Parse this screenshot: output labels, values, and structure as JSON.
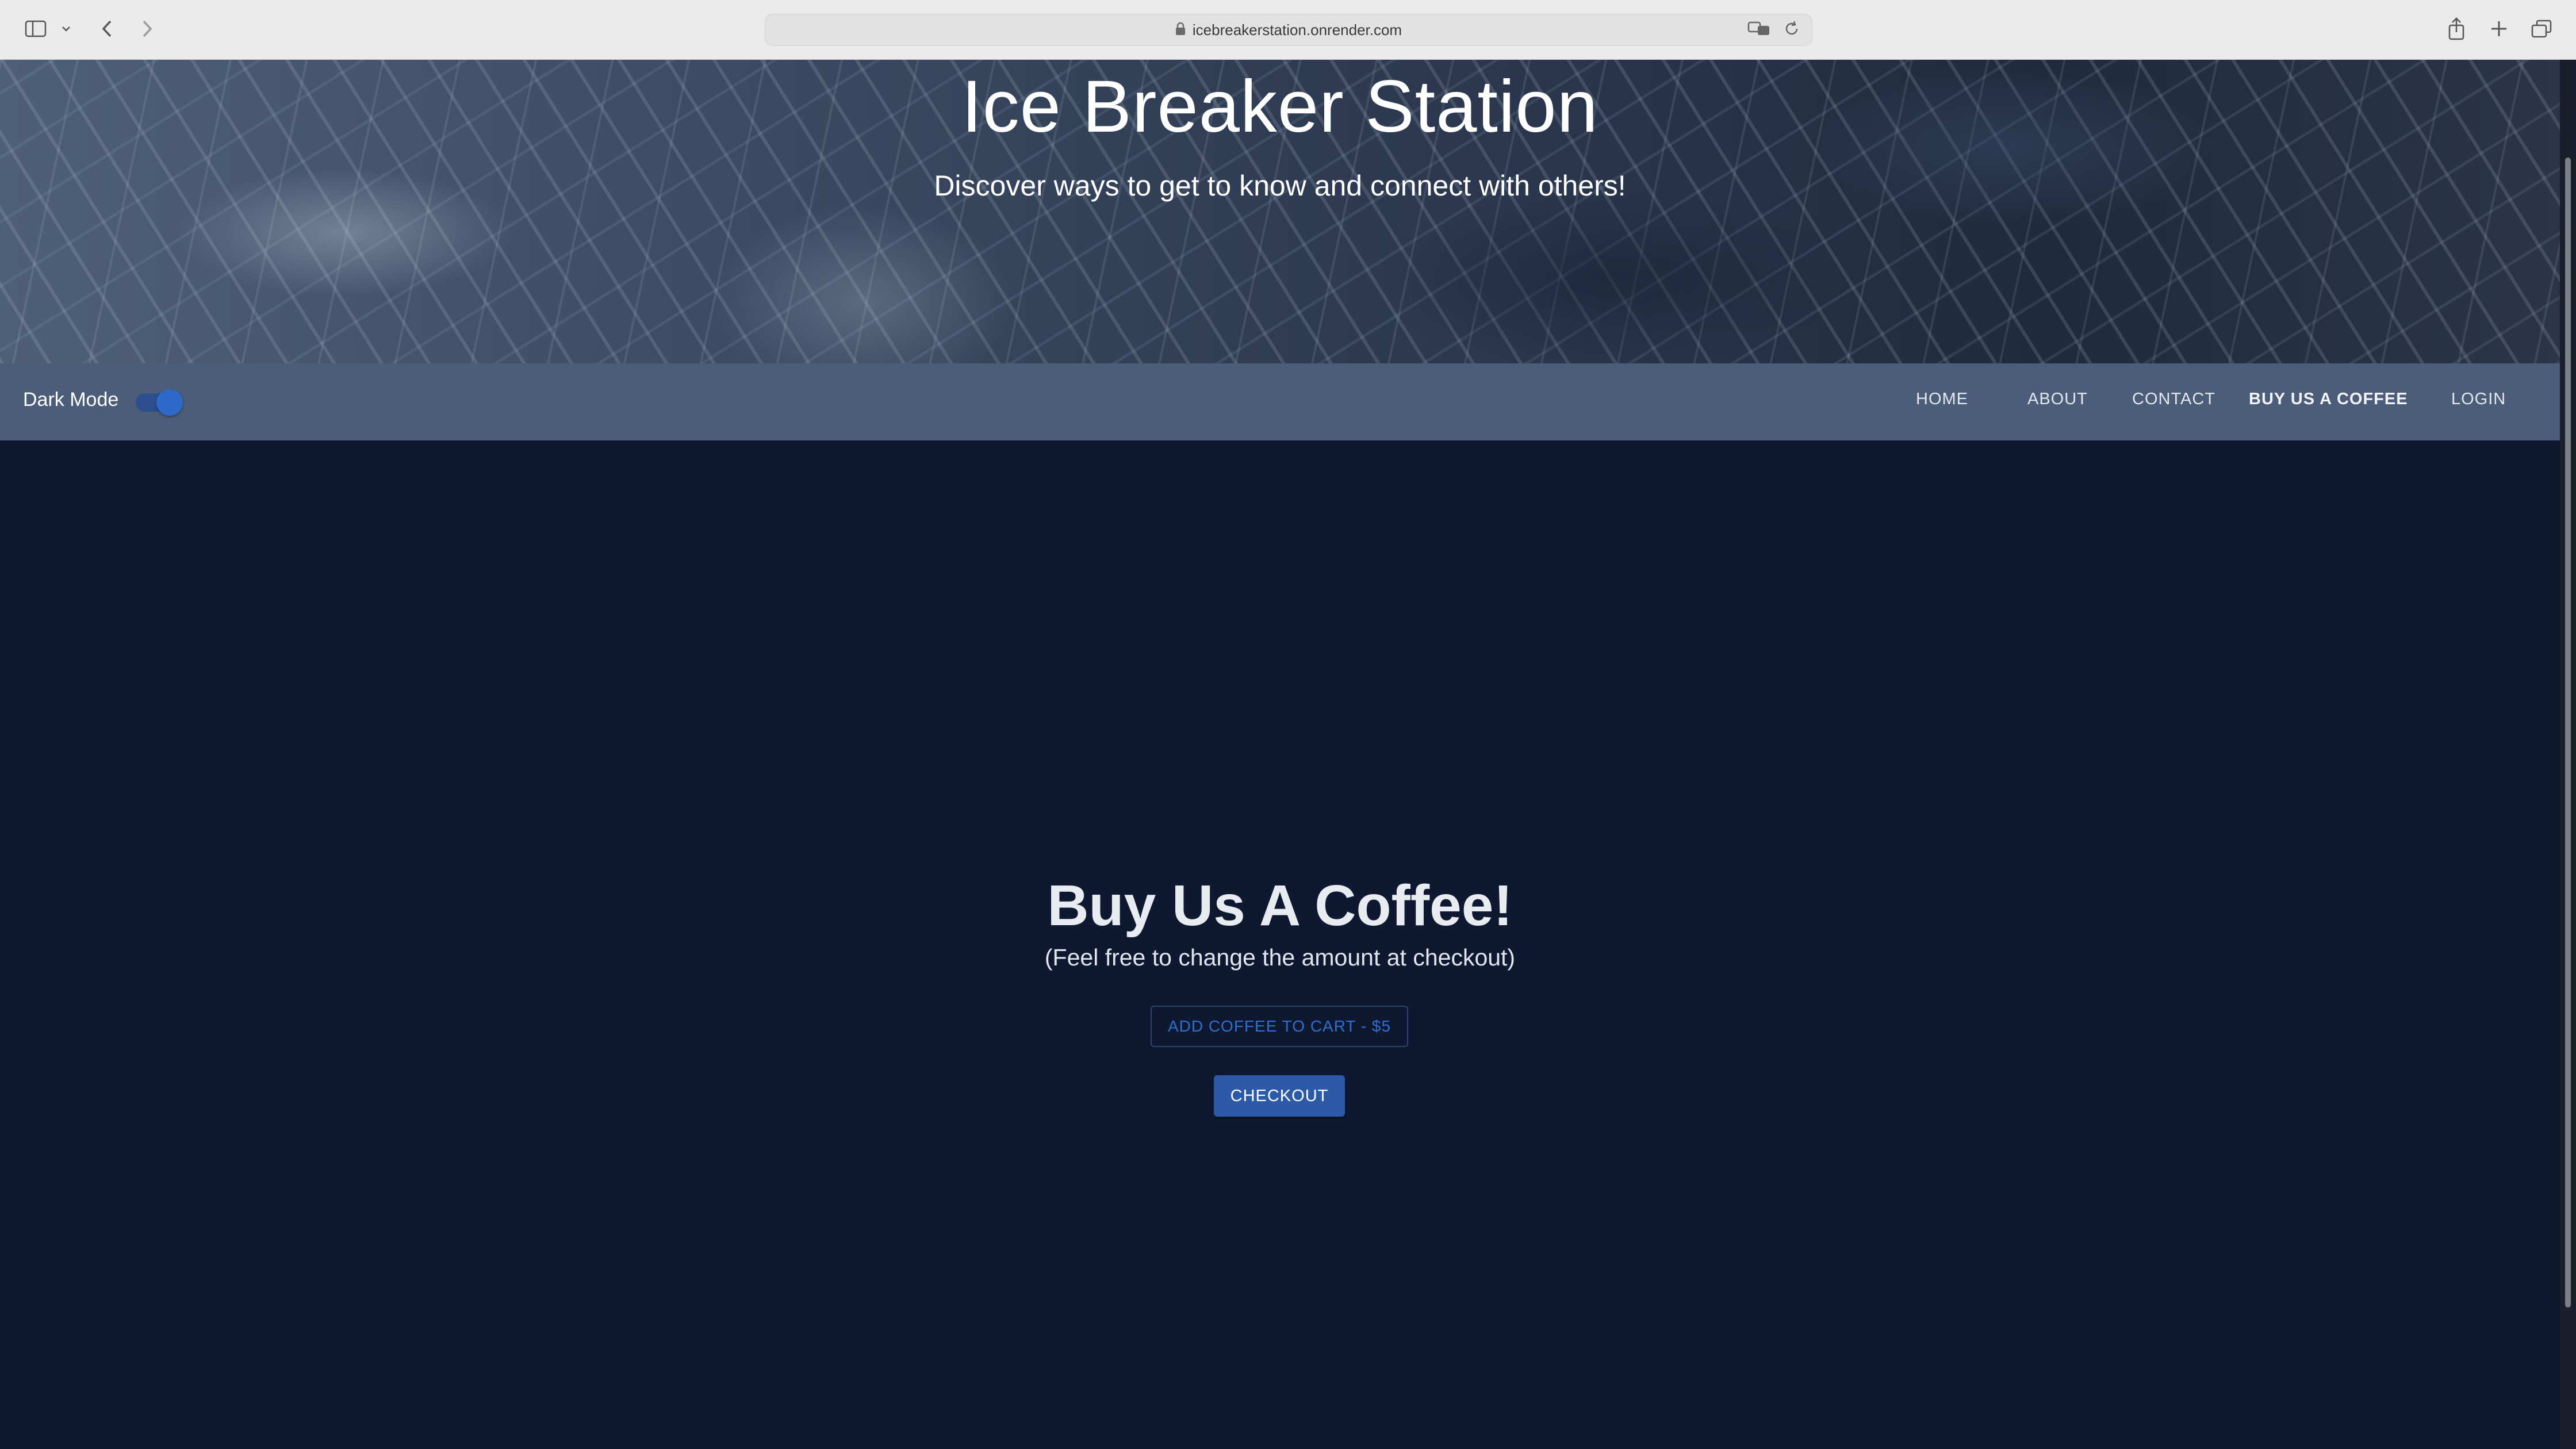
{
  "browser": {
    "url": "icebreakerstation.onrender.com",
    "icons": [
      "sidebar-icon",
      "chevron-down-icon",
      "back-icon",
      "forward-icon",
      "lock-icon",
      "translate-icon",
      "reload-icon",
      "share-icon",
      "new-tab-icon",
      "tabs-overview-icon"
    ]
  },
  "hero": {
    "title": "Ice Breaker Station",
    "subtitle": "Discover ways to get to know and connect with others!"
  },
  "navbar": {
    "dark_mode_label": "Dark Mode",
    "dark_mode_on": true,
    "items": [
      {
        "label": "HOME"
      },
      {
        "label": "ABOUT"
      },
      {
        "label": "CONTACT"
      },
      {
        "label": "BUY US A COFFEE"
      },
      {
        "label": "LOGIN"
      }
    ],
    "active_item": "BUY US A COFFEE"
  },
  "main": {
    "title": "Buy Us A Coffee!",
    "subtitle": "(Feel free to change the amount at checkout)",
    "add_button": "ADD COFFEE TO CART - $5",
    "checkout_button": "CHECKOUT"
  },
  "colors": {
    "background": "#0f1831",
    "navbar": "#4b5d78",
    "accent": "#2c5aa6",
    "toggle": "#2c69c9"
  }
}
